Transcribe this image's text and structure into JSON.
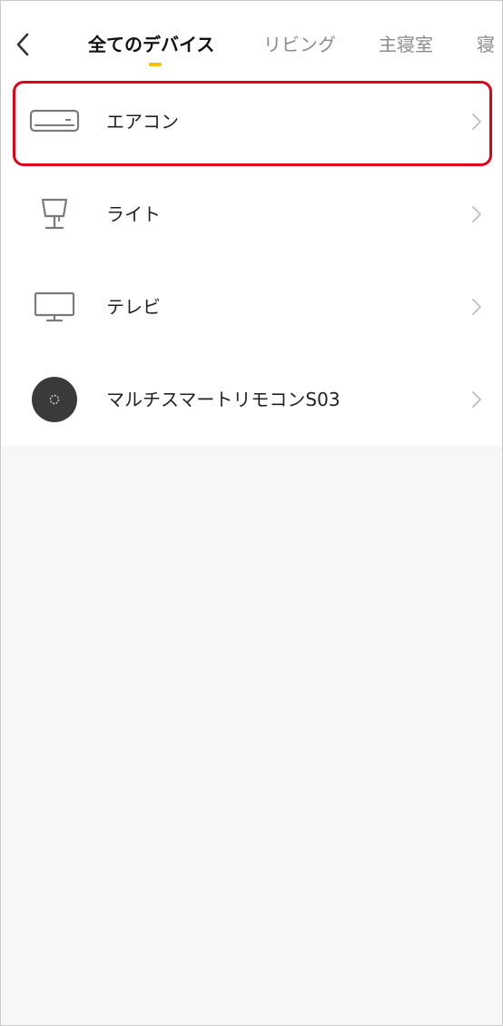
{
  "header": {
    "back_icon": "chevron-left-icon",
    "tabs": [
      {
        "label": "全てのデバイス",
        "active": true
      },
      {
        "label": "リビング",
        "active": false
      },
      {
        "label": "主寝室",
        "active": false
      },
      {
        "label": "寝",
        "active": false
      }
    ]
  },
  "devices": [
    {
      "label": "エアコン",
      "icon": "air-conditioner-icon"
    },
    {
      "label": "ライト",
      "icon": "lamp-icon"
    },
    {
      "label": "テレビ",
      "icon": "tv-icon"
    },
    {
      "label": "マルチスマートリモコンS03",
      "icon": "smart-remote-icon"
    }
  ],
  "colors": {
    "accent": "#f2c200",
    "highlight": "#e3001b",
    "icon_gray": "#7a7a7a",
    "background": "#f7f7f7"
  }
}
